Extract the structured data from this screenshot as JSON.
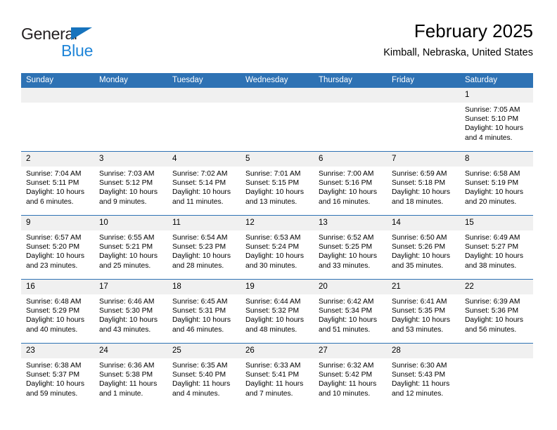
{
  "brand": {
    "logo_word1": "General",
    "logo_word2": "Blue",
    "triangle_color": "#1673bd",
    "blue_color": "#1f85d8"
  },
  "header": {
    "title": "February 2025",
    "location": "Kimball, Nebraska, United States"
  },
  "theme": {
    "header_blue": "#2e72b4",
    "daynum_gray": "#f0f0f0",
    "text_black": "#000000"
  },
  "calendar": {
    "weekday_headers": [
      "Sunday",
      "Monday",
      "Tuesday",
      "Wednesday",
      "Thursday",
      "Friday",
      "Saturday"
    ],
    "labels": {
      "sunrise": "Sunrise:",
      "sunset": "Sunset:",
      "daylight": "Daylight:"
    },
    "weeks": [
      [
        {
          "day": "",
          "empty": true
        },
        {
          "day": "",
          "empty": true
        },
        {
          "day": "",
          "empty": true
        },
        {
          "day": "",
          "empty": true
        },
        {
          "day": "",
          "empty": true
        },
        {
          "day": "",
          "empty": true
        },
        {
          "day": "1",
          "sunrise": "Sunrise: 7:05 AM",
          "sunset": "Sunset: 5:10 PM",
          "daylight1": "Daylight: 10 hours",
          "daylight2": "and 4 minutes."
        }
      ],
      [
        {
          "day": "2",
          "sunrise": "Sunrise: 7:04 AM",
          "sunset": "Sunset: 5:11 PM",
          "daylight1": "Daylight: 10 hours",
          "daylight2": "and 6 minutes."
        },
        {
          "day": "3",
          "sunrise": "Sunrise: 7:03 AM",
          "sunset": "Sunset: 5:12 PM",
          "daylight1": "Daylight: 10 hours",
          "daylight2": "and 9 minutes."
        },
        {
          "day": "4",
          "sunrise": "Sunrise: 7:02 AM",
          "sunset": "Sunset: 5:14 PM",
          "daylight1": "Daylight: 10 hours",
          "daylight2": "and 11 minutes."
        },
        {
          "day": "5",
          "sunrise": "Sunrise: 7:01 AM",
          "sunset": "Sunset: 5:15 PM",
          "daylight1": "Daylight: 10 hours",
          "daylight2": "and 13 minutes."
        },
        {
          "day": "6",
          "sunrise": "Sunrise: 7:00 AM",
          "sunset": "Sunset: 5:16 PM",
          "daylight1": "Daylight: 10 hours",
          "daylight2": "and 16 minutes."
        },
        {
          "day": "7",
          "sunrise": "Sunrise: 6:59 AM",
          "sunset": "Sunset: 5:18 PM",
          "daylight1": "Daylight: 10 hours",
          "daylight2": "and 18 minutes."
        },
        {
          "day": "8",
          "sunrise": "Sunrise: 6:58 AM",
          "sunset": "Sunset: 5:19 PM",
          "daylight1": "Daylight: 10 hours",
          "daylight2": "and 20 minutes."
        }
      ],
      [
        {
          "day": "9",
          "sunrise": "Sunrise: 6:57 AM",
          "sunset": "Sunset: 5:20 PM",
          "daylight1": "Daylight: 10 hours",
          "daylight2": "and 23 minutes."
        },
        {
          "day": "10",
          "sunrise": "Sunrise: 6:55 AM",
          "sunset": "Sunset: 5:21 PM",
          "daylight1": "Daylight: 10 hours",
          "daylight2": "and 25 minutes."
        },
        {
          "day": "11",
          "sunrise": "Sunrise: 6:54 AM",
          "sunset": "Sunset: 5:23 PM",
          "daylight1": "Daylight: 10 hours",
          "daylight2": "and 28 minutes."
        },
        {
          "day": "12",
          "sunrise": "Sunrise: 6:53 AM",
          "sunset": "Sunset: 5:24 PM",
          "daylight1": "Daylight: 10 hours",
          "daylight2": "and 30 minutes."
        },
        {
          "day": "13",
          "sunrise": "Sunrise: 6:52 AM",
          "sunset": "Sunset: 5:25 PM",
          "daylight1": "Daylight: 10 hours",
          "daylight2": "and 33 minutes."
        },
        {
          "day": "14",
          "sunrise": "Sunrise: 6:50 AM",
          "sunset": "Sunset: 5:26 PM",
          "daylight1": "Daylight: 10 hours",
          "daylight2": "and 35 minutes."
        },
        {
          "day": "15",
          "sunrise": "Sunrise: 6:49 AM",
          "sunset": "Sunset: 5:27 PM",
          "daylight1": "Daylight: 10 hours",
          "daylight2": "and 38 minutes."
        }
      ],
      [
        {
          "day": "16",
          "sunrise": "Sunrise: 6:48 AM",
          "sunset": "Sunset: 5:29 PM",
          "daylight1": "Daylight: 10 hours",
          "daylight2": "and 40 minutes."
        },
        {
          "day": "17",
          "sunrise": "Sunrise: 6:46 AM",
          "sunset": "Sunset: 5:30 PM",
          "daylight1": "Daylight: 10 hours",
          "daylight2": "and 43 minutes."
        },
        {
          "day": "18",
          "sunrise": "Sunrise: 6:45 AM",
          "sunset": "Sunset: 5:31 PM",
          "daylight1": "Daylight: 10 hours",
          "daylight2": "and 46 minutes."
        },
        {
          "day": "19",
          "sunrise": "Sunrise: 6:44 AM",
          "sunset": "Sunset: 5:32 PM",
          "daylight1": "Daylight: 10 hours",
          "daylight2": "and 48 minutes."
        },
        {
          "day": "20",
          "sunrise": "Sunrise: 6:42 AM",
          "sunset": "Sunset: 5:34 PM",
          "daylight1": "Daylight: 10 hours",
          "daylight2": "and 51 minutes."
        },
        {
          "day": "21",
          "sunrise": "Sunrise: 6:41 AM",
          "sunset": "Sunset: 5:35 PM",
          "daylight1": "Daylight: 10 hours",
          "daylight2": "and 53 minutes."
        },
        {
          "day": "22",
          "sunrise": "Sunrise: 6:39 AM",
          "sunset": "Sunset: 5:36 PM",
          "daylight1": "Daylight: 10 hours",
          "daylight2": "and 56 minutes."
        }
      ],
      [
        {
          "day": "23",
          "sunrise": "Sunrise: 6:38 AM",
          "sunset": "Sunset: 5:37 PM",
          "daylight1": "Daylight: 10 hours",
          "daylight2": "and 59 minutes."
        },
        {
          "day": "24",
          "sunrise": "Sunrise: 6:36 AM",
          "sunset": "Sunset: 5:38 PM",
          "daylight1": "Daylight: 11 hours",
          "daylight2": "and 1 minute."
        },
        {
          "day": "25",
          "sunrise": "Sunrise: 6:35 AM",
          "sunset": "Sunset: 5:40 PM",
          "daylight1": "Daylight: 11 hours",
          "daylight2": "and 4 minutes."
        },
        {
          "day": "26",
          "sunrise": "Sunrise: 6:33 AM",
          "sunset": "Sunset: 5:41 PM",
          "daylight1": "Daylight: 11 hours",
          "daylight2": "and 7 minutes."
        },
        {
          "day": "27",
          "sunrise": "Sunrise: 6:32 AM",
          "sunset": "Sunset: 5:42 PM",
          "daylight1": "Daylight: 11 hours",
          "daylight2": "and 10 minutes."
        },
        {
          "day": "28",
          "sunrise": "Sunrise: 6:30 AM",
          "sunset": "Sunset: 5:43 PM",
          "daylight1": "Daylight: 11 hours",
          "daylight2": "and 12 minutes."
        },
        {
          "day": "",
          "empty": true
        }
      ]
    ]
  }
}
